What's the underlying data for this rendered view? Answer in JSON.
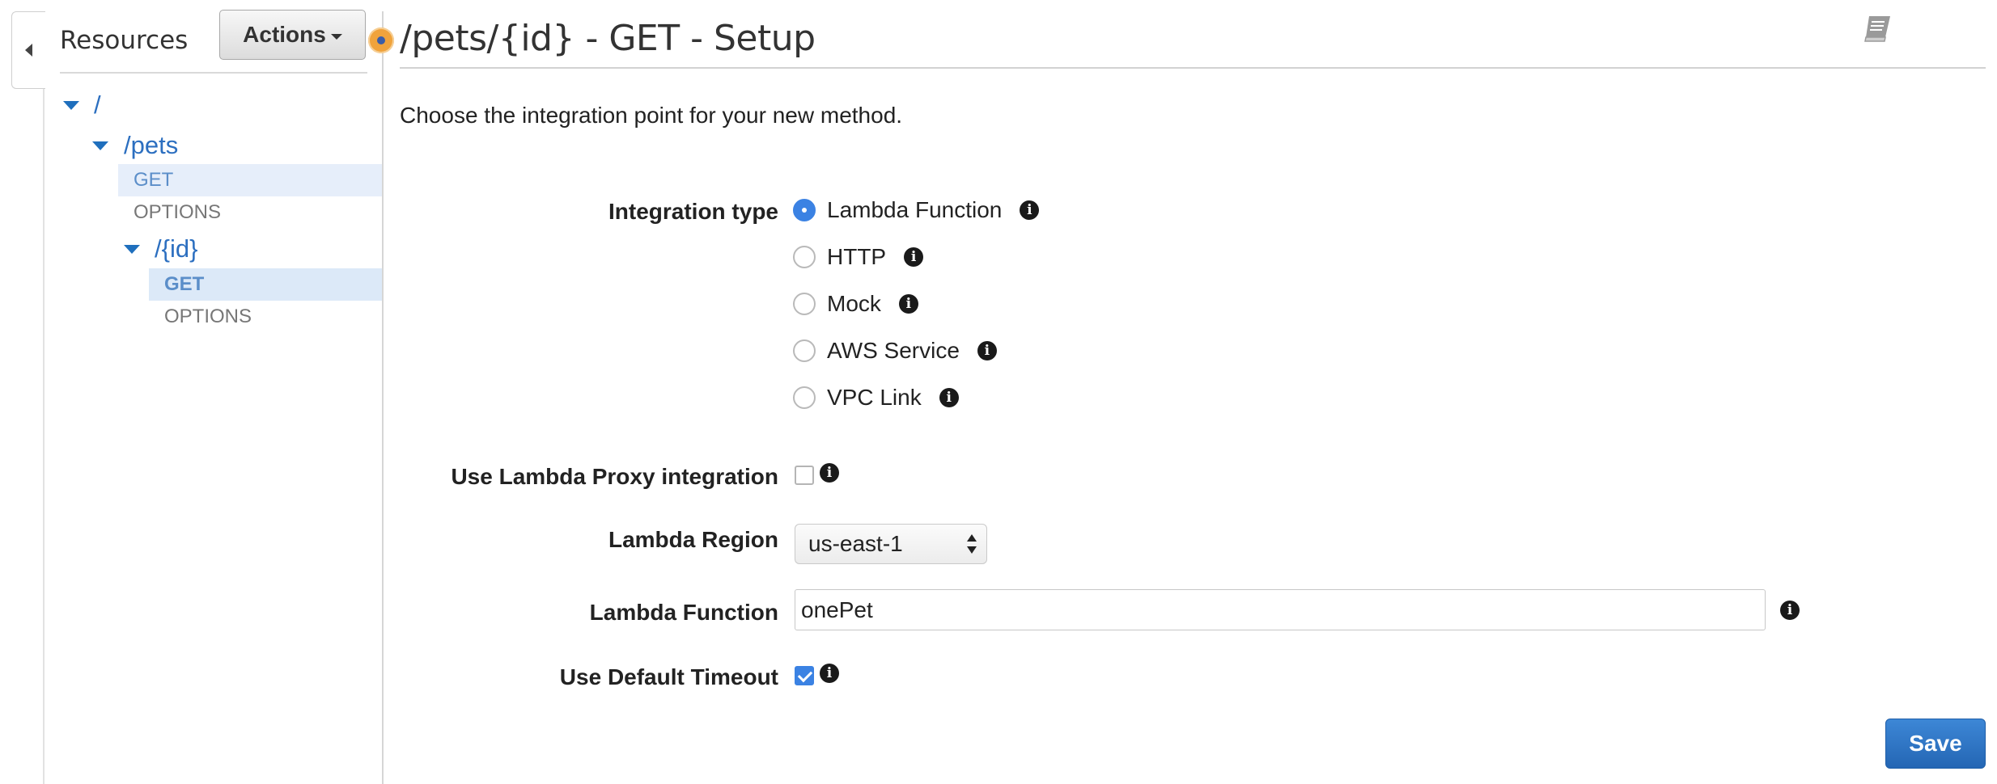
{
  "sidebar": {
    "title": "Resources",
    "actions_label": "Actions",
    "tree": [
      {
        "path": "/"
      },
      {
        "path": "/pets",
        "methods": [
          "GET",
          "OPTIONS"
        ]
      },
      {
        "path": "/{id}",
        "methods": [
          "GET",
          "OPTIONS"
        ]
      }
    ]
  },
  "main": {
    "title": "/pets/{id} - GET - Setup",
    "intro": "Choose the integration point for your new method.",
    "integration_type": {
      "label": "Integration type",
      "selected": "Lambda Function",
      "options": [
        "Lambda Function",
        "HTTP",
        "Mock",
        "AWS Service",
        "VPC Link"
      ]
    },
    "proxy": {
      "label": "Use Lambda Proxy integration",
      "checked": false
    },
    "region": {
      "label": "Lambda Region",
      "value": "us-east-1"
    },
    "function": {
      "label": "Lambda Function",
      "value": "onePet"
    },
    "timeout": {
      "label": "Use Default Timeout",
      "checked": true
    },
    "save_label": "Save"
  },
  "icons": {
    "collapse": "chevron-left-icon",
    "status": "status-dot-icon",
    "docs": "book-icon",
    "info": "info-icon"
  },
  "colors": {
    "link": "#2c6fc0",
    "selected_bg": "#dce9f8",
    "primary": "#2466b4",
    "status": "#f0a33c"
  }
}
